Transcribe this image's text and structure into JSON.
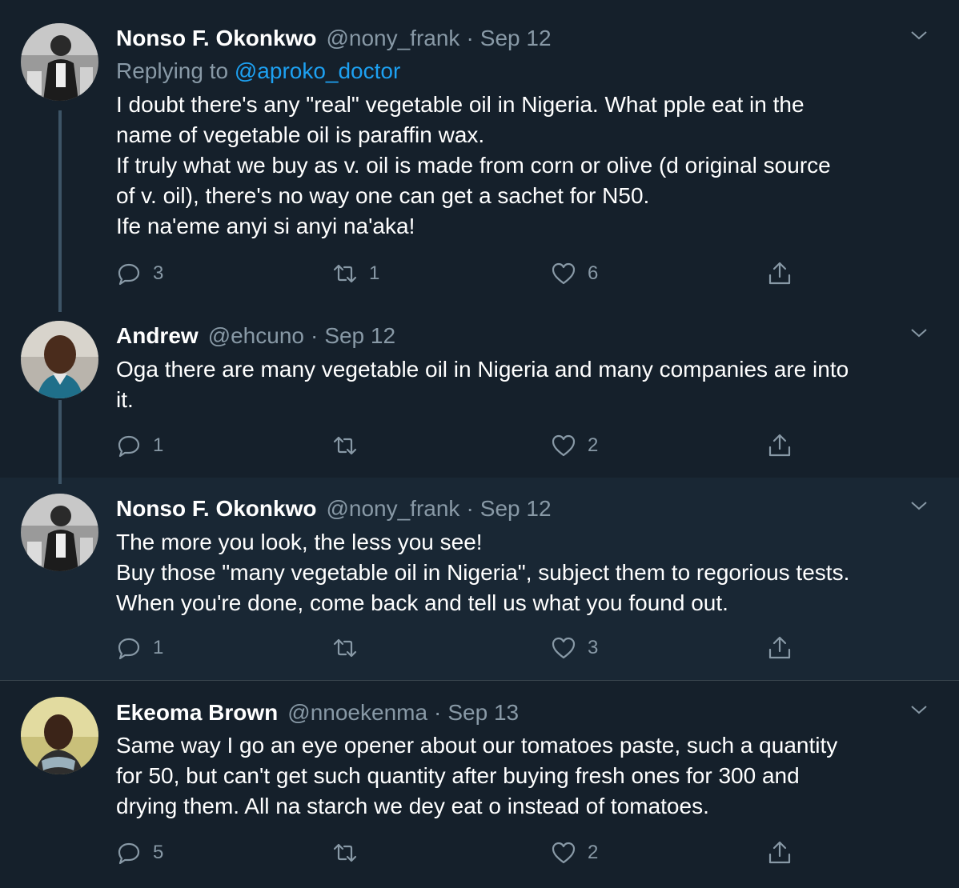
{
  "tweets": [
    {
      "name": "Nonso F. Okonkwo",
      "handle": "@nony_frank",
      "date": "Sep 12",
      "replying_prefix": "Replying to",
      "replying_to": "@aproko_doctor",
      "lines": [
        "I doubt there's any \"real\" vegetable oil in Nigeria. What pple eat in the",
        "name of vegetable oil is paraffin wax.",
        "If truly what we buy as v. oil is made from corn or olive (d original source",
        "of v. oil), there's no way one can get a sachet for N50.",
        "Ife na'eme anyi si anyi na'aka!"
      ],
      "replies": "3",
      "retweets": "1",
      "likes": "6"
    },
    {
      "name": "Andrew",
      "handle": "@ehcuno",
      "date": "Sep 12",
      "lines": [
        "Oga there are many vegetable oil in Nigeria and many companies are into",
        "it."
      ],
      "replies": "1",
      "retweets": "",
      "likes": "2"
    },
    {
      "name": "Nonso F. Okonkwo",
      "handle": "@nony_frank",
      "date": "Sep 12",
      "lines": [
        "The more you look, the less you see!",
        "Buy those \"many vegetable oil in Nigeria\", subject them to regorious tests.",
        "When you're done, come back and tell us what you found out."
      ],
      "replies": "1",
      "retweets": "",
      "likes": "3"
    },
    {
      "name": "Ekeoma Brown",
      "handle": "@nnoekenma",
      "date": "Sep 13",
      "lines": [
        "Same way I go an eye opener about our tomatoes paste, such a quantity",
        "for 50, but can't get such quantity after buying fresh ones for 300 and",
        "drying them. All na starch we dey eat o instead of tomatoes."
      ],
      "replies": "5",
      "retweets": "",
      "likes": "2"
    }
  ],
  "icons": {
    "reply": "reply-icon",
    "retweet": "retweet-icon",
    "like": "heart-icon",
    "share": "share-icon",
    "more": "chevron-down-icon"
  },
  "colors": {
    "background": "#15202b",
    "highlight": "#192734",
    "text": "#ffffff",
    "secondary": "#8899a6",
    "link": "#1da1f2",
    "thread_line": "#3d5466"
  }
}
